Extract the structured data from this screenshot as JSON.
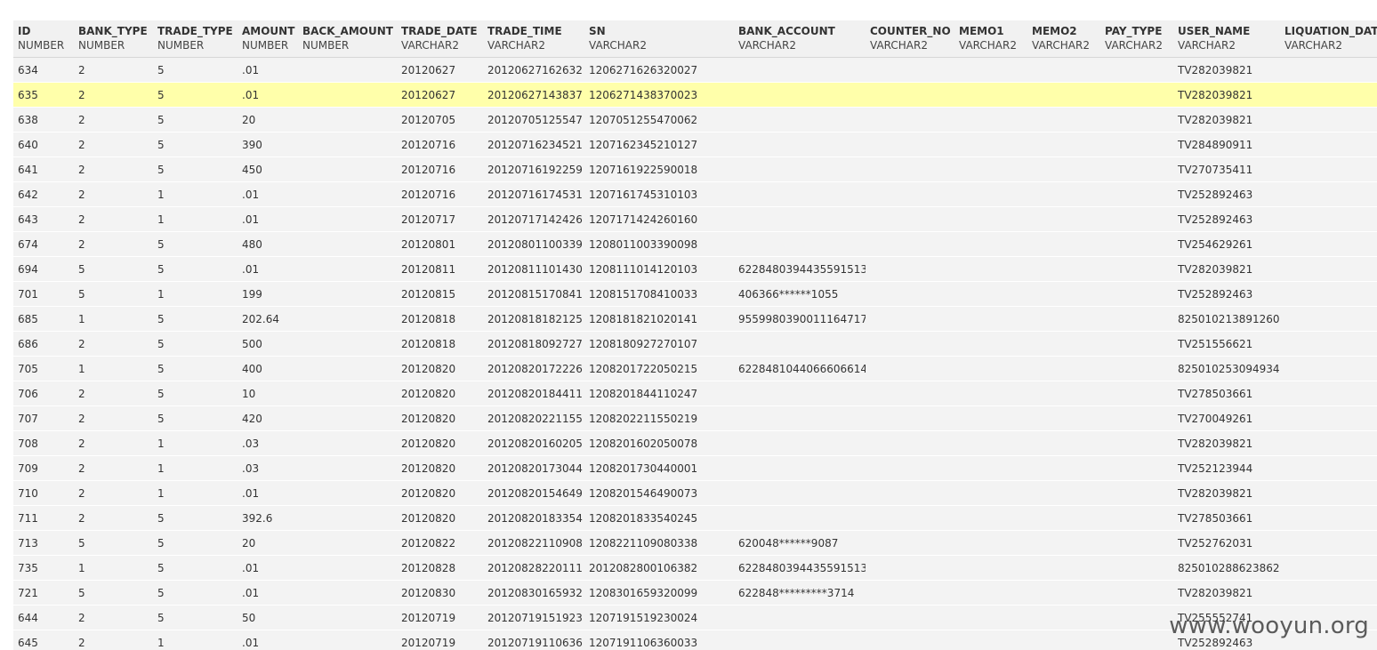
{
  "header_text": "",
  "columns": [
    {
      "name": "ID",
      "type": "NUMBER"
    },
    {
      "name": "BANK_TYPE",
      "type": "NUMBER"
    },
    {
      "name": "TRADE_TYPE",
      "type": "NUMBER"
    },
    {
      "name": "AMOUNT",
      "type": "NUMBER"
    },
    {
      "name": "BACK_AMOUNT",
      "type": "NUMBER"
    },
    {
      "name": "TRADE_DATE",
      "type": "VARCHAR2"
    },
    {
      "name": "TRADE_TIME",
      "type": "VARCHAR2"
    },
    {
      "name": "SN",
      "type": "VARCHAR2"
    },
    {
      "name": "BANK_ACCOUNT",
      "type": "VARCHAR2"
    },
    {
      "name": "COUNTER_NO",
      "type": "VARCHAR2"
    },
    {
      "name": "MEMO1",
      "type": "VARCHAR2"
    },
    {
      "name": "MEMO2",
      "type": "VARCHAR2"
    },
    {
      "name": "PAY_TYPE",
      "type": "VARCHAR2"
    },
    {
      "name": "USER_NAME",
      "type": "VARCHAR2"
    },
    {
      "name": "LIQUATION_DATE",
      "type": "VARCHAR2"
    }
  ],
  "highlighted_row": 1,
  "rows": [
    [
      "634",
      "2",
      "5",
      ".01",
      "",
      "20120627",
      "20120627162632",
      "1206271626320027",
      "",
      "",
      "",
      "",
      "",
      "TV282039821",
      ""
    ],
    [
      "635",
      "2",
      "5",
      ".01",
      "",
      "20120627",
      "20120627143837",
      "1206271438370023",
      "",
      "",
      "",
      "",
      "",
      "TV282039821",
      ""
    ],
    [
      "638",
      "2",
      "5",
      "20",
      "",
      "20120705",
      "20120705125547",
      "1207051255470062",
      "",
      "",
      "",
      "",
      "",
      "TV282039821",
      ""
    ],
    [
      "640",
      "2",
      "5",
      "390",
      "",
      "20120716",
      "20120716234521",
      "1207162345210127",
      "",
      "",
      "",
      "",
      "",
      "TV284890911",
      ""
    ],
    [
      "641",
      "2",
      "5",
      "450",
      "",
      "20120716",
      "20120716192259",
      "1207161922590018",
      "",
      "",
      "",
      "",
      "",
      "TV270735411",
      ""
    ],
    [
      "642",
      "2",
      "1",
      ".01",
      "",
      "20120716",
      "20120716174531",
      "1207161745310103",
      "",
      "",
      "",
      "",
      "",
      "TV252892463",
      ""
    ],
    [
      "643",
      "2",
      "1",
      ".01",
      "",
      "20120717",
      "20120717142426",
      "1207171424260160",
      "",
      "",
      "",
      "",
      "",
      "TV252892463",
      ""
    ],
    [
      "674",
      "2",
      "5",
      "480",
      "",
      "20120801",
      "20120801100339",
      "1208011003390098",
      "",
      "",
      "",
      "",
      "",
      "TV254629261",
      ""
    ],
    [
      "694",
      "5",
      "5",
      ".01",
      "",
      "20120811",
      "20120811101430",
      "1208111014120103",
      "6228480394435591513",
      "",
      "",
      "",
      "",
      "TV282039821",
      ""
    ],
    [
      "701",
      "5",
      "1",
      "199",
      "",
      "20120815",
      "20120815170841",
      "1208151708410033",
      "406366******1055",
      "",
      "",
      "",
      "",
      "TV252892463",
      ""
    ],
    [
      "685",
      "1",
      "5",
      "202.64",
      "",
      "20120818",
      "20120818182125",
      "1208181821020141",
      "9559980390011164717",
      "",
      "",
      "",
      "",
      "825010213891260",
      ""
    ],
    [
      "686",
      "2",
      "5",
      "500",
      "",
      "20120818",
      "20120818092727",
      "1208180927270107",
      "",
      "",
      "",
      "",
      "",
      "TV251556621",
      ""
    ],
    [
      "705",
      "1",
      "5",
      "400",
      "",
      "20120820",
      "20120820172226",
      "1208201722050215",
      "6228481044066606614",
      "",
      "",
      "",
      "",
      "825010253094934",
      ""
    ],
    [
      "706",
      "2",
      "5",
      "10",
      "",
      "20120820",
      "20120820184411",
      "1208201844110247",
      "",
      "",
      "",
      "",
      "",
      "TV278503661",
      ""
    ],
    [
      "707",
      "2",
      "5",
      "420",
      "",
      "20120820",
      "20120820221155",
      "1208202211550219",
      "",
      "",
      "",
      "",
      "",
      "TV270049261",
      ""
    ],
    [
      "708",
      "2",
      "1",
      ".03",
      "",
      "20120820",
      "20120820160205",
      "1208201602050078",
      "",
      "",
      "",
      "",
      "",
      "TV282039821",
      ""
    ],
    [
      "709",
      "2",
      "1",
      ".03",
      "",
      "20120820",
      "20120820173044",
      "1208201730440001",
      "",
      "",
      "",
      "",
      "",
      "TV252123944",
      ""
    ],
    [
      "710",
      "2",
      "1",
      ".01",
      "",
      "20120820",
      "20120820154649",
      "1208201546490073",
      "",
      "",
      "",
      "",
      "",
      "TV282039821",
      ""
    ],
    [
      "711",
      "2",
      "5",
      "392.6",
      "",
      "20120820",
      "20120820183354",
      "1208201833540245",
      "",
      "",
      "",
      "",
      "",
      "TV278503661",
      ""
    ],
    [
      "713",
      "5",
      "5",
      "20",
      "",
      "20120822",
      "20120822110908",
      "1208221109080338",
      "620048******9087",
      "",
      "",
      "",
      "",
      "TV252762031",
      ""
    ],
    [
      "735",
      "1",
      "5",
      ".01",
      "",
      "20120828",
      "20120828220111",
      "2012082800106382",
      "6228480394435591513",
      "",
      "",
      "",
      "",
      "825010288623862",
      ""
    ],
    [
      "721",
      "5",
      "5",
      ".01",
      "",
      "20120830",
      "20120830165932",
      "1208301659320099",
      "622848*********3714",
      "",
      "",
      "",
      "",
      "TV282039821",
      ""
    ],
    [
      "644",
      "2",
      "5",
      "50",
      "",
      "20120719",
      "20120719151923",
      "1207191519230024",
      "",
      "",
      "",
      "",
      "",
      "TV255552741",
      ""
    ],
    [
      "645",
      "2",
      "1",
      ".01",
      "",
      "20120719",
      "20120719110636",
      "1207191106360033",
      "",
      "",
      "",
      "",
      "",
      "TV252892463",
      ""
    ]
  ],
  "watermark": "www.wooyun.org"
}
